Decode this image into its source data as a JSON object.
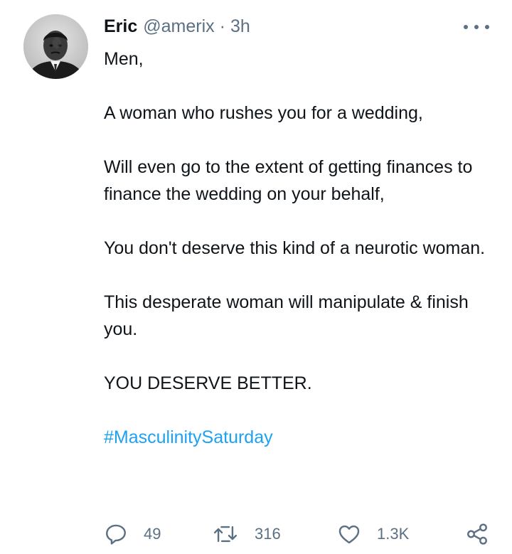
{
  "tweet": {
    "author_name": "Eric",
    "author_handle": "@amerix",
    "separator": "·",
    "time": "3h",
    "paragraphs": [
      "Men,",
      "A woman who rushes you for a wedding,",
      "Will even go to the extent of getting finances to finance the wedding on your behalf,",
      "You don't deserve this kind of a neurotic woman.",
      "This desperate woman will manipulate & finish you.",
      "YOU DESERVE BETTER."
    ],
    "hashtag": "#MasculinitySaturday"
  },
  "actions": {
    "reply_count": "49",
    "retweet_count": "316",
    "like_count": "1.3K"
  },
  "icons": {
    "more": "more-horizontal-icon",
    "reply": "reply-icon",
    "retweet": "retweet-icon",
    "like": "heart-icon",
    "share": "share-icon"
  },
  "colors": {
    "text": "#0f1419",
    "secondary": "#5b7083",
    "link": "#1da1f2"
  }
}
